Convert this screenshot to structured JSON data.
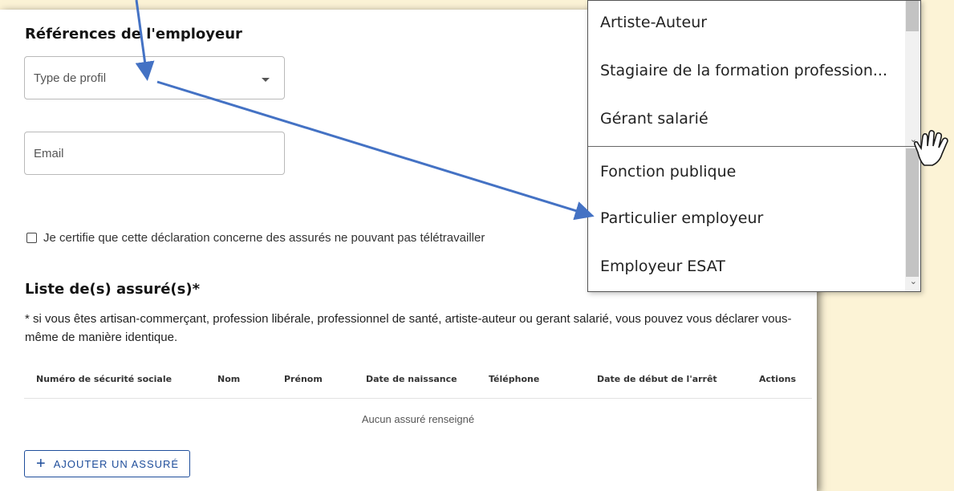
{
  "employer_section": {
    "title": "Références de l'employeur",
    "profile_type_placeholder": "Type de profil",
    "email_placeholder": "Email",
    "certify_label": "Je certifie que cette déclaration concerne des assurés ne pouvant pas télétravailler"
  },
  "insured_section": {
    "title": "Liste de(s) assuré(s)*",
    "note": "* si vous êtes artisan-commerçant, profession libérale, professionnel de santé, artiste-auteur ou gerant salarié, vous pouvez vous déclarer vous-même de manière identique.",
    "columns": [
      "Numéro de sécurité sociale",
      "Nom",
      "Prénom",
      "Date de naissance",
      "Téléphone",
      "Date de début de l'arrêt",
      "Actions"
    ],
    "empty_text": "Aucun assuré renseigné",
    "add_button_icon": "plus-icon",
    "add_button_label": "Ajouter un assuré"
  },
  "dropdown": {
    "items_top": [
      "Artiste-Auteur",
      "Stagiaire de la formation profession...",
      "Gérant salarié"
    ],
    "items_bottom": [
      "Fonction publique",
      "Particulier employeur",
      "Employeur ESAT"
    ]
  },
  "annotations": {
    "arrow_color": "#4472c4",
    "cursor_icon": "hand-pointer-icon"
  }
}
